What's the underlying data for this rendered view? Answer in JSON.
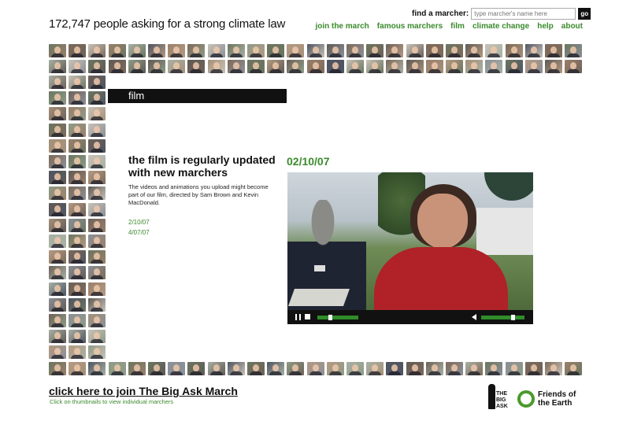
{
  "header": {
    "headline": "172,747 people asking for a strong climate law",
    "search": {
      "label": "find a marcher:",
      "placeholder": "type marcher's name here",
      "go_label": "go"
    },
    "nav": [
      "join the march",
      "famous marchers",
      "film",
      "climate change",
      "help",
      "about"
    ]
  },
  "section": {
    "title": "film"
  },
  "info": {
    "title": "the film is regularly updated with new marchers",
    "body": "The videos and animations you upload might become part of our film, directed by Sam Brown and Kevin MacDonald.",
    "dates": [
      "2/10/07",
      "4/07/07"
    ]
  },
  "video": {
    "date": "02/10/07"
  },
  "footer": {
    "cta": "click here to join The Big Ask March",
    "cta_sub": "Click on thumbnails to view individual marchers",
    "logo_bigask": [
      "THE",
      "BIG",
      "ASK"
    ],
    "logo_foe": [
      "Friends of",
      "the Earth"
    ]
  },
  "colors": {
    "accent_green": "#3a8a2c",
    "header_bar": "#111111",
    "video_shirt_red": "#b02227"
  }
}
